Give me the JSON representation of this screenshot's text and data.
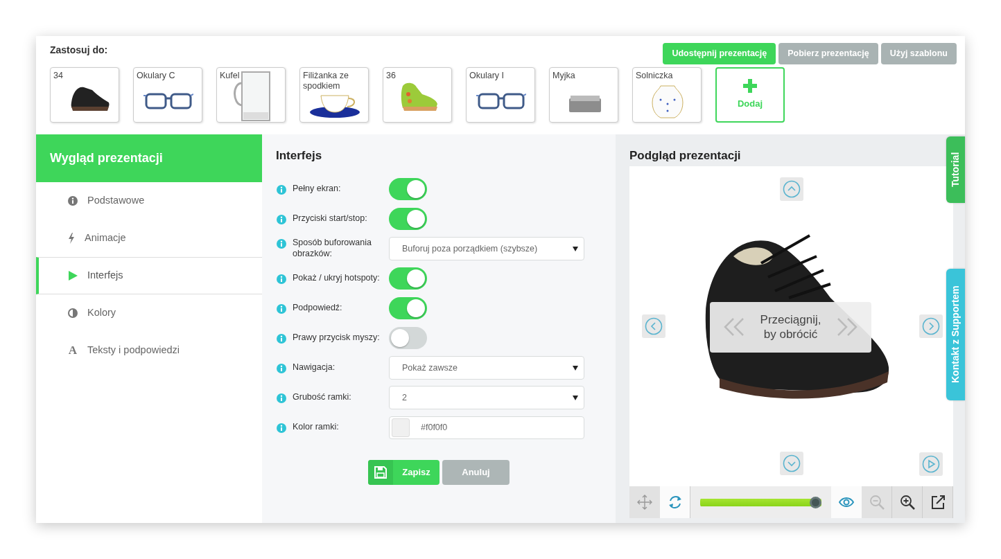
{
  "apply_to": {
    "label": "Zastosuj do:",
    "items": [
      {
        "label": "34",
        "kind": "shoe"
      },
      {
        "label": "Okulary C",
        "kind": "glasses"
      },
      {
        "label": "Kufel",
        "kind": "mug"
      },
      {
        "label": "Filiżanka ze spodkiem",
        "kind": "cup"
      },
      {
        "label": "36",
        "kind": "boot"
      },
      {
        "label": "Okulary I",
        "kind": "glasses"
      },
      {
        "label": "Myjka",
        "kind": "sink"
      },
      {
        "label": "Solniczka",
        "kind": "vase"
      }
    ],
    "add_button": "Dodaj"
  },
  "top_buttons": [
    {
      "label": "Udostępnij prezentację",
      "kind": "primary"
    },
    {
      "label": "Pobierz prezentację",
      "kind": "secondary"
    },
    {
      "label": "Użyj szablonu",
      "kind": "secondary"
    }
  ],
  "sidebar": {
    "title": "Wygląd prezentacji",
    "items": [
      {
        "label": "Podstawowe",
        "kind": "info",
        "selected": false
      },
      {
        "label": "Animacje",
        "kind": "bolt",
        "selected": false
      },
      {
        "label": "Interfejs",
        "kind": "play",
        "selected": true
      },
      {
        "label": "Kolory",
        "kind": "contrast",
        "selected": false
      },
      {
        "label": "Teksty i podpowiedzi",
        "kind": "font",
        "glyph": "A",
        "selected": false
      }
    ]
  },
  "settings": {
    "title": "Interfejs",
    "rows": [
      {
        "label": "Pełny ekran:",
        "kind": "toggle",
        "on": true
      },
      {
        "label": "Przyciski start/stop:",
        "kind": "toggle",
        "on": true
      },
      {
        "label": "Sposób buforowania obrazków:",
        "kind": "select",
        "value": "Buforuj poza porządkiem (szybsze)"
      },
      {
        "label": "Pokaż / ukryj hotspoty:",
        "kind": "toggle",
        "on": true
      },
      {
        "label": "Podpowiedź:",
        "kind": "toggle",
        "on": true
      },
      {
        "label": "Prawy przycisk myszy:",
        "kind": "toggle",
        "on": false
      },
      {
        "label": "Nawigacja:",
        "kind": "select",
        "value": "Pokaż zawsze"
      },
      {
        "label": "Grubość ramki:",
        "kind": "select",
        "value": "2"
      },
      {
        "label": "Kolor ramki:",
        "kind": "color",
        "value": "#f0f0f0"
      }
    ],
    "save_button": "Zapisz",
    "cancel_button": "Anuluj"
  },
  "preview": {
    "title": "Podgląd prezentacji",
    "hint": "Przeciągnij, by obrócić",
    "tools": [
      {
        "kind": "move",
        "selected": false,
        "disabled": false
      },
      {
        "kind": "rotate",
        "selected": true,
        "disabled": false
      },
      {
        "kind": "slider",
        "level": 1.0
      },
      {
        "kind": "eye",
        "selected": true,
        "disabled": false
      },
      {
        "kind": "zoom-out",
        "selected": false,
        "disabled": true
      },
      {
        "kind": "zoom-in",
        "selected": false,
        "disabled": false
      },
      {
        "kind": "external",
        "selected": false,
        "disabled": false
      }
    ]
  },
  "side_tabs": [
    {
      "label": "Tutorial",
      "kind": "tutorial"
    },
    {
      "label": "Kontakt z Supportem",
      "kind": "support"
    }
  ]
}
